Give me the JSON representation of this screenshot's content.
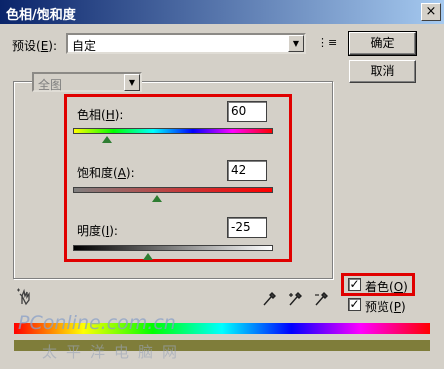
{
  "window": {
    "title": "色相/饱和度",
    "close_glyph": "×"
  },
  "preset": {
    "label_prefix": "预设(",
    "label_key": "E",
    "label_suffix": "):",
    "value": "自定",
    "menu_glyph": "⋮≡"
  },
  "buttons": {
    "ok": "确定",
    "cancel": "取消"
  },
  "range_select": {
    "value": "全图"
  },
  "sliders": [
    {
      "label_prefix": "色相(",
      "key": "H",
      "label_suffix": "):",
      "value": "60",
      "fraction": 0.17
    },
    {
      "label_prefix": "饱和度(",
      "key": "A",
      "label_suffix": "):",
      "value": "42",
      "fraction": 0.42
    },
    {
      "label_prefix": "明度(",
      "key": "I",
      "label_suffix": "):",
      "value": "-25",
      "fraction": 0.375
    }
  ],
  "options": {
    "colorize": {
      "prefix": "着色(",
      "key": "O",
      "suffix": ")",
      "checked": true,
      "check_glyph": "✓"
    },
    "preview": {
      "prefix": "预览(",
      "key": "P",
      "suffix": ")",
      "checked": true,
      "check_glyph": "✓"
    }
  },
  "watermark": {
    "line1": "PConline.com.cn",
    "line2": "太平洋电脑网"
  },
  "icons": [
    "adjust-hand-icon",
    "eyedropper-icon",
    "eyedropper-plus-icon",
    "eyedropper-minus-icon"
  ]
}
